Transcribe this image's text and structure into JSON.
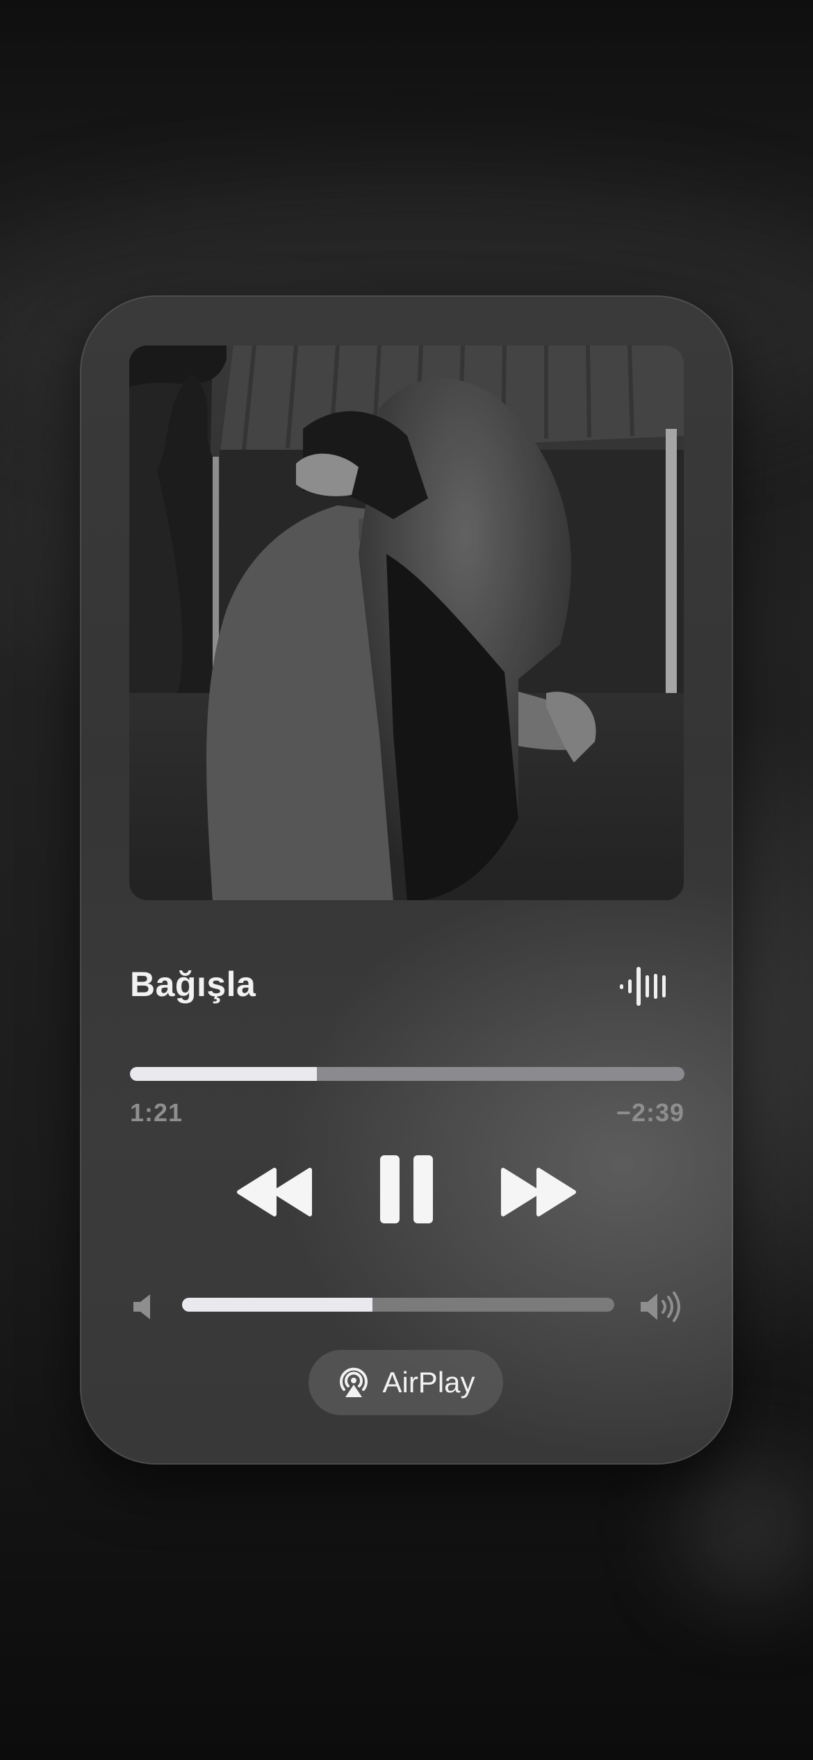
{
  "player": {
    "song_title": "Bağışla",
    "elapsed": "1:21",
    "remaining": "−2:39",
    "progress_fraction": 0.337,
    "volume_fraction": 0.44,
    "airplay_label": "AirPlay",
    "artwork_description_icon": "photo"
  },
  "icons": {
    "waveform": "waveform-icon",
    "rewind": "rewind-icon",
    "pause": "pause-icon",
    "fast_forward": "fast-forward-icon",
    "volume_low": "speaker-low-icon",
    "volume_high": "speaker-high-icon",
    "airplay": "airplay-icon"
  },
  "colors": {
    "accent": "#e9e9ee",
    "track": "#8a8a8f",
    "card": "#383838"
  }
}
